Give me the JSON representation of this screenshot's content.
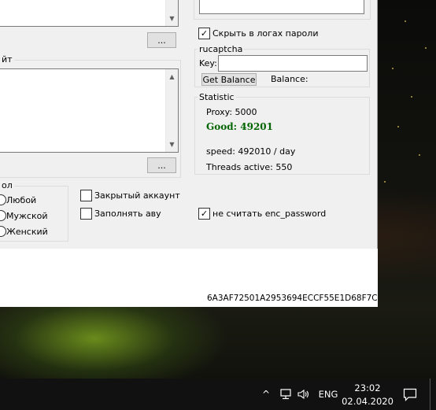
{
  "top_left": {
    "browse_button": "..."
  },
  "site_box": {
    "legend": "йт",
    "browse_button": "..."
  },
  "settings": {
    "hide_passwords_label": "Скрыть в логах пароли",
    "hide_passwords_checked": true
  },
  "rucaptcha": {
    "legend": "rucaptcha",
    "key_label": "Key:",
    "key_value": "",
    "get_balance_label": "Get Balance",
    "balance_label": "Balance:"
  },
  "statistic": {
    "legend": "Statistic",
    "proxy_text": "Proxy: 5000",
    "good_text": "Good: 49201",
    "speed_text": "speed: 492010 / day",
    "threads_text": "Threads active: 550",
    "good_color": "#006400"
  },
  "gender": {
    "legend": "ол",
    "options": [
      "Любой",
      "Мужской",
      "Женский"
    ]
  },
  "options": {
    "closed_account_label": "Закрытый аккаунт",
    "closed_account_checked": false,
    "fill_avatar_label": "Заполнять аву",
    "fill_avatar_checked": false,
    "no_enc_password_label": "не считать enc_password",
    "no_enc_password_checked": true
  },
  "hardware_id": "6A3AF72501A2953694ECCF55E1D68F7C",
  "taskbar": {
    "language": "ENG",
    "time": "23:02",
    "date": "02.04.2020"
  }
}
